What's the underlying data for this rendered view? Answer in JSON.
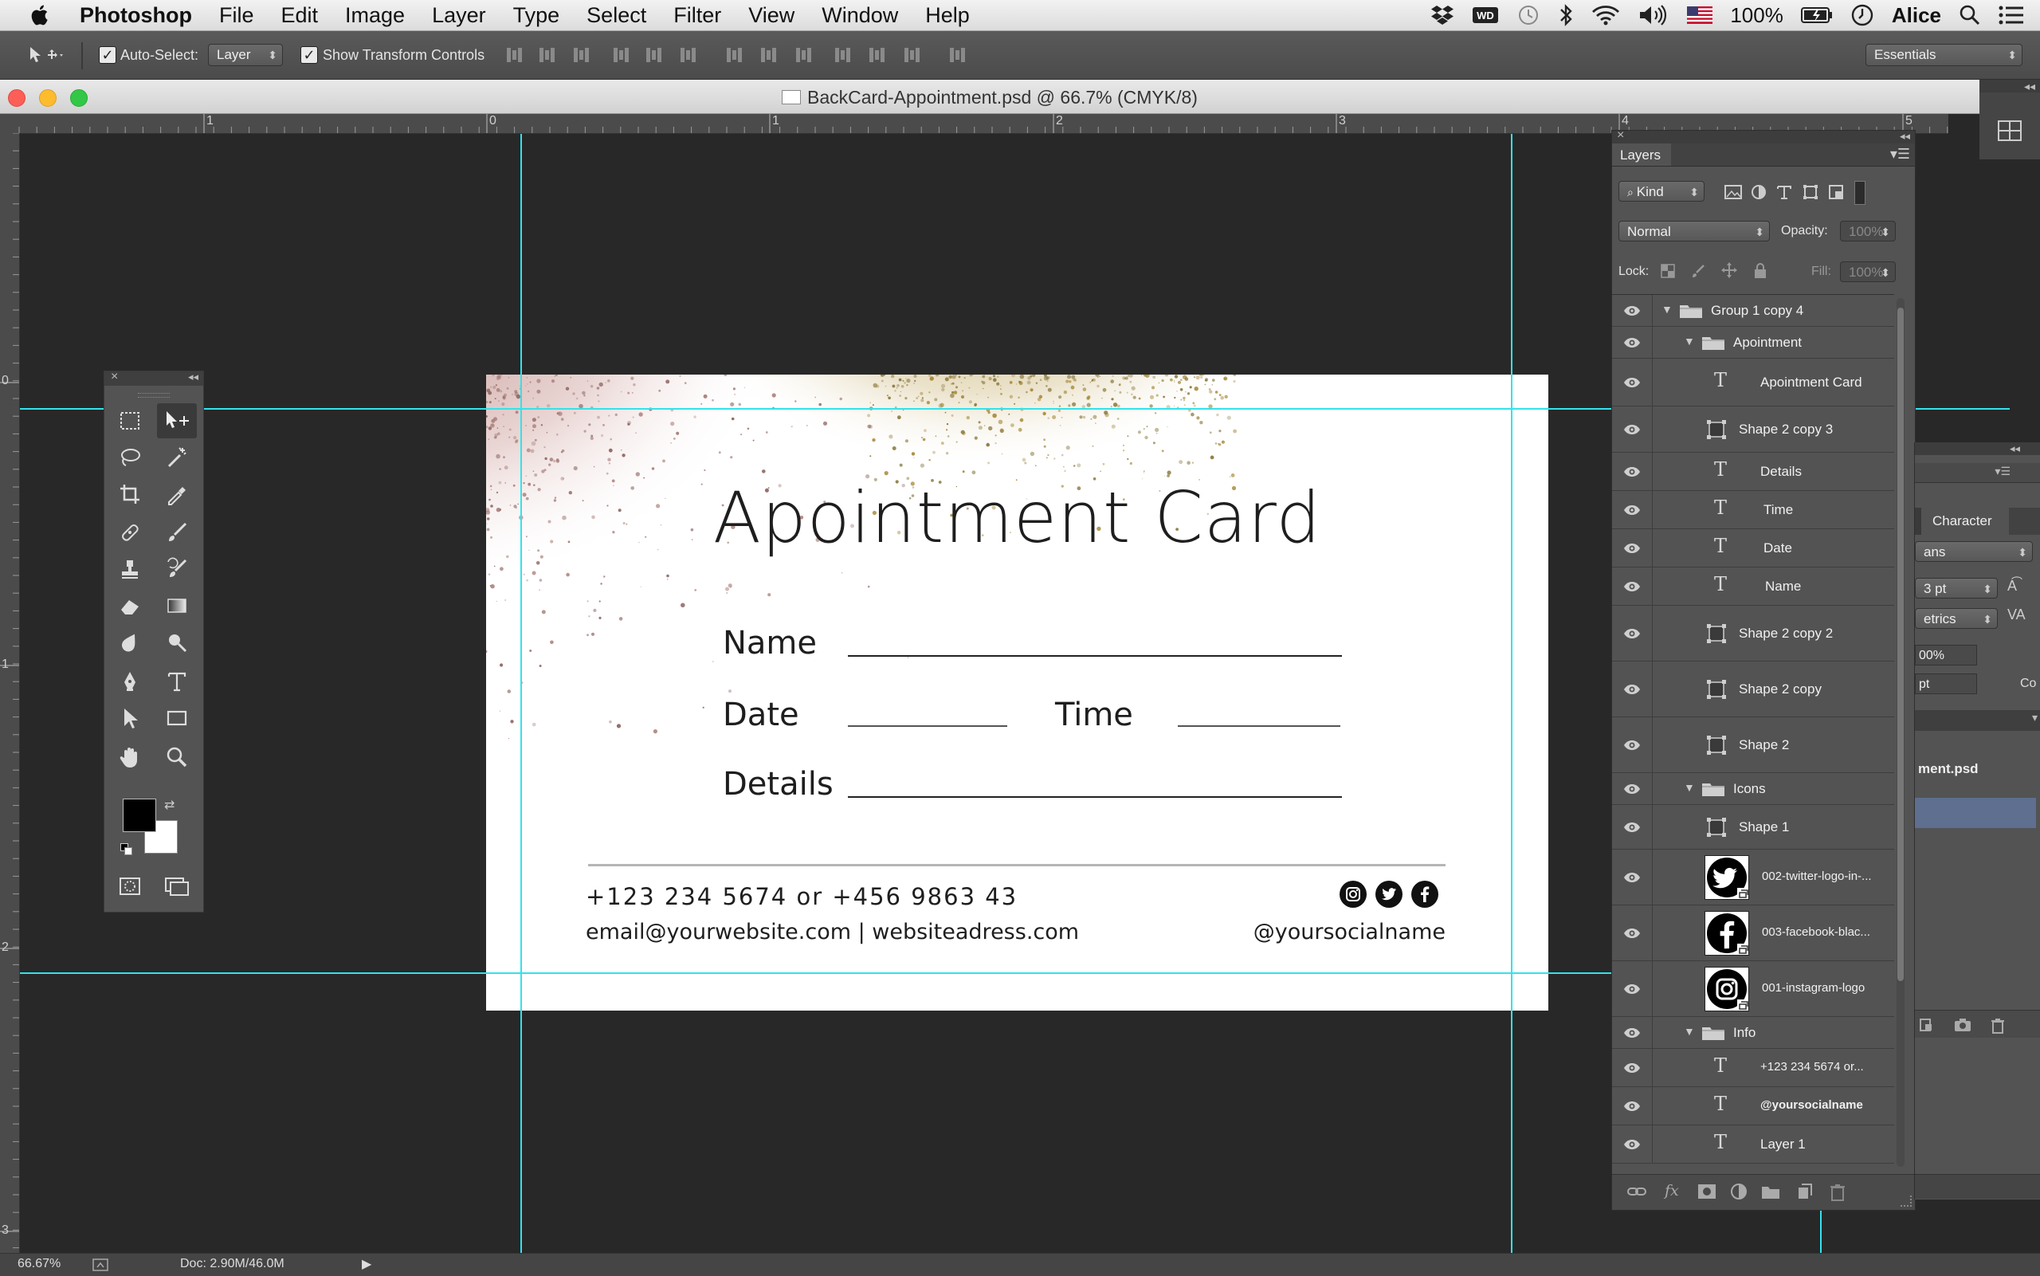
{
  "menubar": {
    "app_name": "Photoshop",
    "items": [
      "File",
      "Edit",
      "Image",
      "Layer",
      "Type",
      "Select",
      "Filter",
      "View",
      "Window",
      "Help"
    ],
    "battery": "100%",
    "user": "Alice"
  },
  "options": {
    "auto_select_label": "Auto-Select:",
    "auto_select_value": "Layer",
    "show_transform_label": "Show Transform Controls",
    "workspace": "Essentials"
  },
  "document": {
    "title": "BackCard-Appointment.psd @ 66.7% (CMYK/8)",
    "zoom": "66.67%",
    "doc_size": "Doc: 2.90M/46.0M"
  },
  "rulers": {
    "h_labels": [
      "1",
      "0",
      "1",
      "2",
      "3",
      "4",
      "5"
    ],
    "v_labels": [
      "0",
      "1",
      "2",
      "3"
    ]
  },
  "card": {
    "title": "Apointment Card",
    "name_label": "Name",
    "date_label": "Date",
    "time_label": "Time",
    "details_label": "Details",
    "phone": "+123 234 5674 or +456 9863 43",
    "contact": "email@yourwebsite.com | websiteadress.com",
    "social": "@yoursocialname"
  },
  "layers": {
    "tab": "Layers",
    "filter_kind": "Kind",
    "blend_mode": "Normal",
    "opacity_label": "Opacity:",
    "opacity_value": "100%",
    "lock_label": "Lock:",
    "fill_label": "Fill:",
    "fill_value": "100%",
    "rows": [
      {
        "name": "Group 1 copy 4",
        "kind": "group"
      },
      {
        "name": "Apointment",
        "kind": "group"
      },
      {
        "name": "Apointment Card",
        "kind": "text"
      },
      {
        "name": "Shape 2 copy 3",
        "kind": "shape"
      },
      {
        "name": "Details",
        "kind": "text"
      },
      {
        "name": "Time",
        "kind": "text"
      },
      {
        "name": "Date",
        "kind": "text"
      },
      {
        "name": "Name",
        "kind": "text"
      },
      {
        "name": "Shape 2 copy 2",
        "kind": "shape"
      },
      {
        "name": "Shape 2 copy",
        "kind": "shape"
      },
      {
        "name": "Shape 2",
        "kind": "shape"
      },
      {
        "name": "Icons",
        "kind": "group"
      },
      {
        "name": "Shape 1",
        "kind": "shape"
      },
      {
        "name": "002-twitter-logo-in-...",
        "kind": "smart"
      },
      {
        "name": "003-facebook-blac...",
        "kind": "smart"
      },
      {
        "name": "001-instagram-logo",
        "kind": "smart"
      },
      {
        "name": "Info",
        "kind": "group"
      },
      {
        "name": "+123 234 5674 or...",
        "kind": "text"
      },
      {
        "name": "@yoursocialname",
        "kind": "text"
      },
      {
        "name": "Layer 1",
        "kind": "text"
      }
    ]
  },
  "character": {
    "tab": "Character",
    "font_partial": "ans",
    "size_partial": "3 pt",
    "kerning_partial": "etrics",
    "scale_partial": "00%",
    "baseline_partial": "pt",
    "color_partial": "Co",
    "file_partial": "ment.psd"
  }
}
